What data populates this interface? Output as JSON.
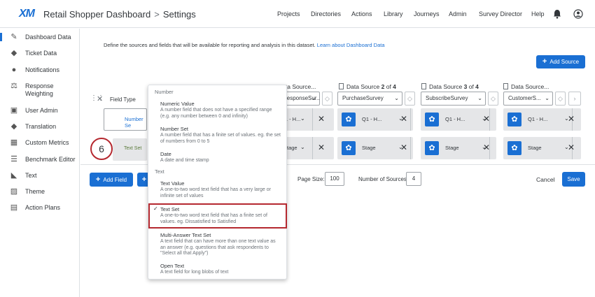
{
  "header": {
    "logo": "XM",
    "title": "Retail Shopper Dashboard",
    "separator": ">",
    "subtitle": "Settings",
    "nav": [
      "Projects",
      "Directories",
      "Actions",
      "Library",
      "Journeys",
      "Admin",
      "Survey Director",
      "Help"
    ]
  },
  "sidebar": {
    "items": [
      {
        "label": "Dashboard Data",
        "icon": "pencil-icon"
      },
      {
        "label": "Ticket Data",
        "icon": "tag-icon"
      },
      {
        "label": "Notifications",
        "icon": "bell-icon"
      },
      {
        "label": "Response Weighting",
        "icon": "scale-icon"
      },
      {
        "label": "User Admin",
        "icon": "user-card-icon"
      },
      {
        "label": "Translation",
        "icon": "translate-tag-icon"
      },
      {
        "label": "Custom Metrics",
        "icon": "calculator-icon"
      },
      {
        "label": "Benchmark Editor",
        "icon": "benchmark-icon"
      },
      {
        "label": "Text",
        "icon": "chat-icon"
      },
      {
        "label": "Theme",
        "icon": "palette-icon"
      },
      {
        "label": "Action Plans",
        "icon": "clipboard-icon"
      }
    ]
  },
  "main": {
    "intro": "Define the sources and fields that will be available for reporting and analysis in this dataset.",
    "intro_link": "Learn about Dashboard Data",
    "add_source": "Add Source",
    "field_type_label": "Field Type",
    "sources": [
      {
        "header_prefix": "Data Source",
        "header_suffix": "",
        "select": "ResponseSur..."
      },
      {
        "header_prefix": "Data Source ",
        "num": "2",
        "of": " of ",
        "total": "4",
        "select": "PurchaseSurvey"
      },
      {
        "header_prefix": "Data Source ",
        "num": "3",
        "of": " of ",
        "total": "4",
        "select": "SubscribeSurvey"
      },
      {
        "header_prefix": "Data Source",
        "header_suffix": "",
        "select": "CustomerS..."
      }
    ],
    "row1_cells": [
      "Q1 - H...",
      "Q1 - H...",
      "Q1 - H...",
      "Q1 - H..."
    ],
    "row2_cells": [
      "Stage",
      "Stage",
      "Stage",
      "Stage"
    ],
    "number_set_label": "Number Se",
    "text_set_label": "Text Set",
    "step_number": "6",
    "add_field": "Add Field",
    "page_size_label": "Page Size:",
    "page_size_value": "100",
    "num_sources_label": "Number of Sources:",
    "num_sources_value": "4",
    "cancel": "Cancel",
    "save": "Save"
  },
  "dropdown": {
    "group_number": "Number",
    "group_text": "Text",
    "options": [
      {
        "title": "Numeric Value",
        "desc": "A number field that does not have a specified range (e.g. any number between 0 and infinity)"
      },
      {
        "title": "Number Set",
        "desc": "A number field that has a finite set of values. eg. the set of numbers from 0 to 5"
      },
      {
        "title": "Date",
        "desc": "A date and time stamp"
      },
      {
        "title": "Text Value",
        "desc": "A one-to-two word text field that has a very large or infinite set of values"
      },
      {
        "title": "Text Set",
        "desc": "A one-to-two word text field that has a finite set of values. eg. Dissatisfied to Satisfied"
      },
      {
        "title": "Multi-Answer Text Set",
        "desc": "A text field that can have more than one text value as an answer (e.g. questions that ask respondents to \"Select all that Apply\")"
      },
      {
        "title": "Open Text",
        "desc": "A text field for long blobs of text"
      }
    ],
    "checkmark": "✓"
  },
  "colors": {
    "accent": "#1a6fd3",
    "highlight": "#b5282f"
  }
}
